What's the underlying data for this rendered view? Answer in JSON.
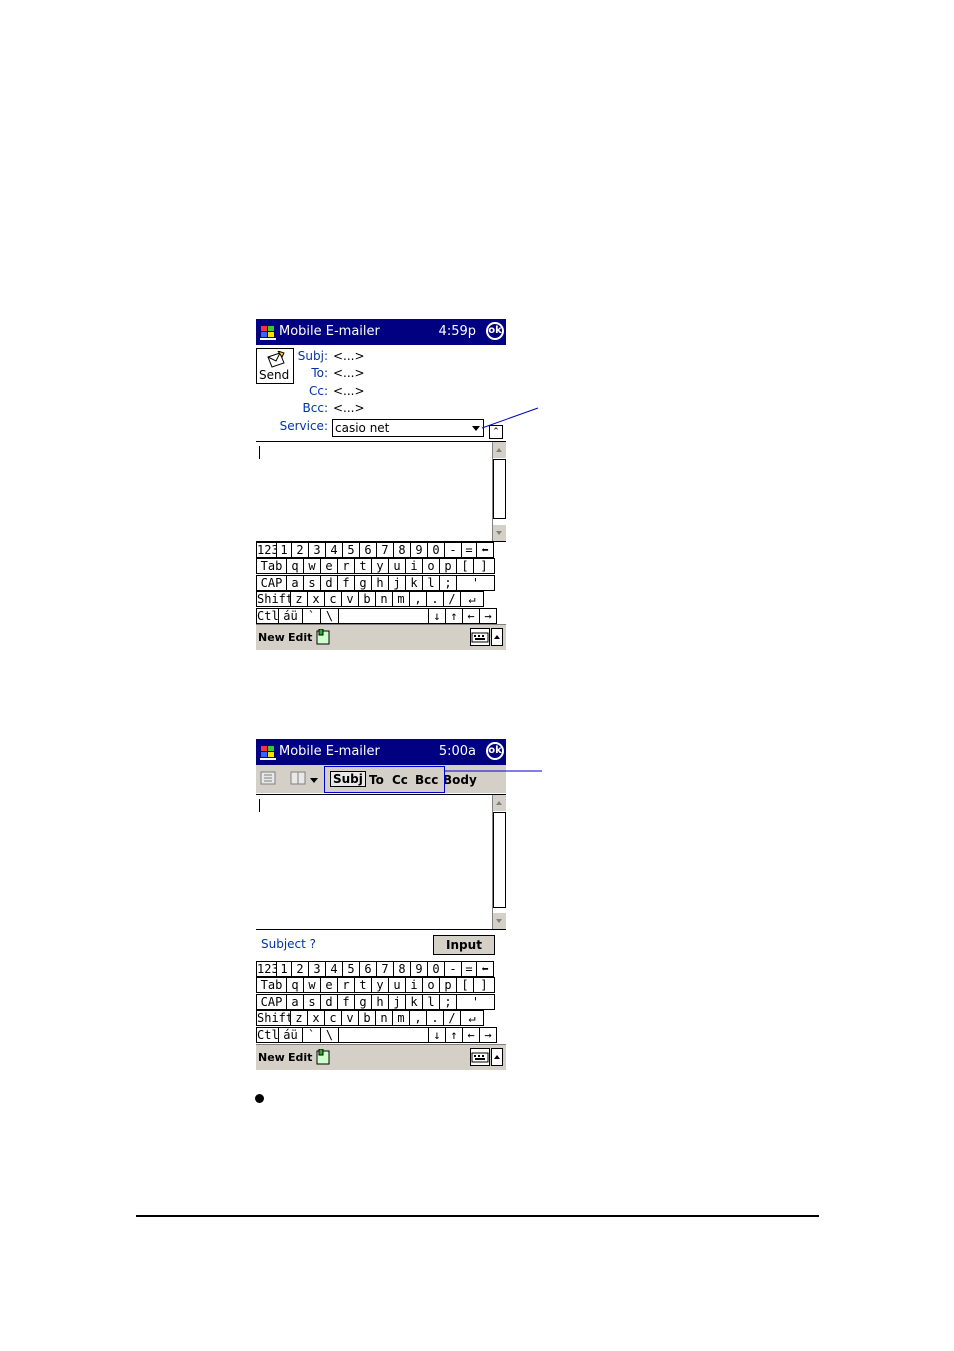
{
  "screens": [
    {
      "title": "Mobile E-mailer",
      "time": "4:59p",
      "ok": "ok",
      "send_label": "Send",
      "headers": [
        {
          "label": "Subj:",
          "value": "<...>"
        },
        {
          "label": "To:",
          "value": "<...>"
        },
        {
          "label": "Cc:",
          "value": "<...>"
        },
        {
          "label": "Bcc:",
          "value": "<...>"
        }
      ],
      "service_label": "Service:",
      "service_value": "casio net",
      "menus": [
        "New",
        "Edit"
      ]
    },
    {
      "title": "Mobile E-mailer",
      "time": "5:00a",
      "ok": "ok",
      "field_tabs": [
        "Subj",
        "To",
        "Cc",
        "Bcc",
        "Body"
      ],
      "selected_tab": "Subj",
      "prompt": "Subject ?",
      "input_label": "Input",
      "menus": [
        "New",
        "Edit"
      ]
    }
  ],
  "keyboard": {
    "rows": [
      [
        "123",
        "1",
        "2",
        "3",
        "4",
        "5",
        "6",
        "7",
        "8",
        "9",
        "0",
        "-",
        "=",
        "⬅"
      ],
      [
        "Tab",
        "q",
        "w",
        "e",
        "r",
        "t",
        "y",
        "u",
        "i",
        "o",
        "p",
        "[",
        "]"
      ],
      [
        "CAP",
        "a",
        "s",
        "d",
        "f",
        "g",
        "h",
        "j",
        "k",
        "l",
        ";",
        "'"
      ],
      [
        "Shift",
        "z",
        "x",
        "c",
        "v",
        "b",
        "n",
        "m",
        ",",
        ".",
        "/",
        "↵"
      ],
      [
        "Ctl",
        "áü",
        "`",
        "\\",
        " ",
        "↓",
        "↑",
        "←",
        "→"
      ]
    ]
  },
  "colors": {
    "titlebar": "#000080",
    "label_blue": "#0033aa",
    "bar_gray": "#d4d0c8"
  }
}
